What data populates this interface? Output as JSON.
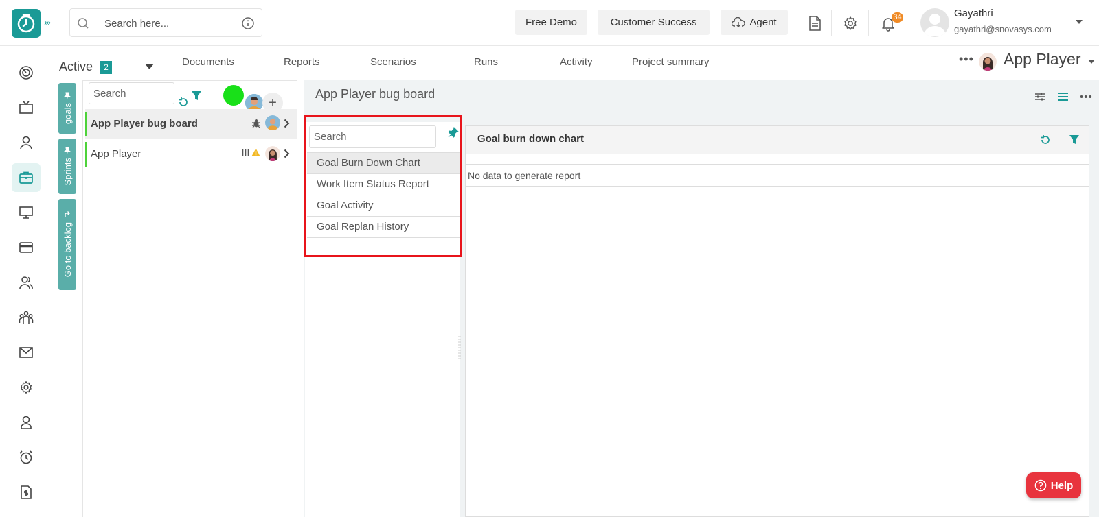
{
  "topbar": {
    "search_placeholder": "Search here...",
    "free_demo": "Free Demo",
    "customer_success": "Customer Success",
    "agent": "Agent",
    "notification_count": "34",
    "user_name": "Gayathri",
    "user_email": "gayathri@snovasys.com"
  },
  "subheader": {
    "status": "Active",
    "status_count": "2",
    "tabs": [
      "Documents",
      "Reports",
      "Scenarios",
      "Runs",
      "Activity",
      "Project summary"
    ],
    "project_name": "App Player"
  },
  "side_pills": [
    "goals",
    "Sprints",
    "Go to backlog"
  ],
  "goals_panel": {
    "search_placeholder": "Search",
    "goals": [
      "App Player bug board",
      "App Player"
    ]
  },
  "board": {
    "title": "App Player bug board",
    "report_search_placeholder": "Search",
    "reports": [
      "Goal Burn Down Chart",
      "Work Item Status Report",
      "Goal Activity",
      "Goal Replan History"
    ],
    "chart_title": "Goal burn down chart",
    "empty_message": "No data to generate report"
  },
  "help": {
    "label": "Help"
  },
  "colors": {
    "brand": "#1a9a96",
    "highlight": "#e8141b",
    "help": "#e8343e",
    "badge": "#f08a24"
  }
}
